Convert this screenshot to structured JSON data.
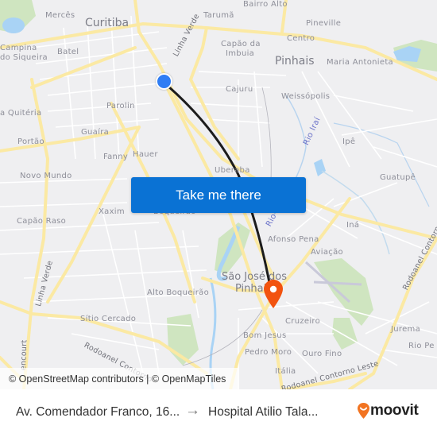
{
  "map": {
    "labels": {
      "curitiba": "Curitiba",
      "merces": "Mercês",
      "taruma": "Tarumã",
      "bairro_alto": "Bairro Alto",
      "pineville": "Pineville",
      "centro": "Centro",
      "campina": "Campina",
      "do_siqueira": "do Siqueira",
      "batel": "Batel",
      "capao_da": "Capão da",
      "imbuia": "Imbuia",
      "pinhais": "Pinhais",
      "maria_antonieta": "Maria Antonieta",
      "linha_verde_north": "Linha Verde",
      "cajuru": "Cajuru",
      "weissopolis": "Weissópolis",
      "parolin": "Parolin",
      "santa_quiteria": "a Quitéria",
      "guaira": "Guaíra",
      "rio_iraí": "Rio Iraí",
      "ipe": "Ipê",
      "portao": "Portão",
      "fanny": "Fanny",
      "hauer": "Hauer",
      "uberaba": "Uberaba",
      "guatupe": "Guatupê",
      "novo_mundo": "Novo Mundo",
      "xaxim": "Xaxim",
      "boqueirao": "Boqueirão",
      "rio_south": "Rio",
      "capao_raso": "Capão Raso",
      "afonso_pena": "Afonso Pena",
      "ina": "Iná",
      "aviacao": "Aviação",
      "rodoanel_east": "Rodoanel Contorno",
      "linha_verde_south": "Linha Verde",
      "sao_jose": "São José dos",
      "pinhais_sjp": "Pinhais",
      "alto_boqueirao": "Alto Boqueirão",
      "sitio_cercado": "Sítio Cercado",
      "cruzeiro": "Cruzeiro",
      "jurema": "Jurema",
      "bom_jesus": "Bom Jesus",
      "rio_pe": "Rio Pe",
      "pedro_moro": "Pedro Moro",
      "ouro_fino": "Ouro Fino",
      "rodoanel_sw": "Rodoanel Contorno",
      "italia": "Itália",
      "encourt": "encourt",
      "rodoanel_leste": "Rodoanel Contorno Leste"
    },
    "attribution": "© OpenStreetMap contributors | © OpenMapTiles",
    "cta_label": "Take me there",
    "colors": {
      "background": "#efeff1",
      "major_road": "#fbe9a3",
      "minor_road": "#ffffff",
      "water": "#a9d3f5",
      "park": "#cfe5c0",
      "route": "#1c1c1c",
      "origin": "#2f7df4",
      "destination": "#f2530f",
      "cta": "#0a72d4"
    }
  },
  "footer": {
    "origin": "Av. Comendador Franco, 16...",
    "arrow": "→",
    "destination": "Hospital Atilio Tala...",
    "brand": "moovit"
  }
}
